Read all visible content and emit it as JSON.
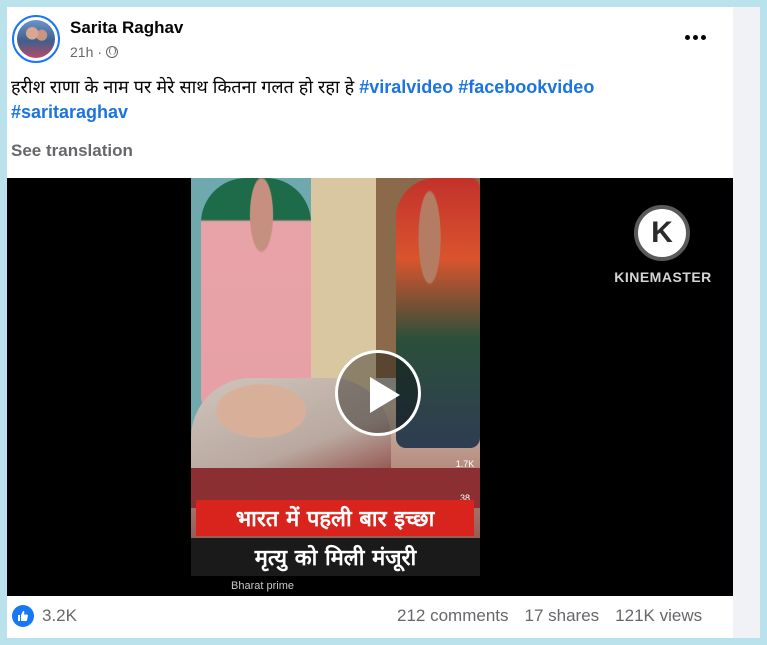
{
  "post": {
    "author": "Sarita Raghav",
    "time": "21h",
    "separator": "·",
    "caption_text": "हरीश राणा के नाम पर मेरे साथ कितना गलत हो रहा हे",
    "hashtags": [
      "#viralvideo",
      "#facebookvideo",
      "#saritaraghav"
    ],
    "see_translation": "See translation"
  },
  "video": {
    "watermark": "KINEMASTER",
    "logo_letter": "K",
    "banner_line1": "भारत में पहली बार इच्छा",
    "banner_line2": "मृत्यु को मिली मंजूरी",
    "channel_text": "Bharat prime",
    "side_counts": [
      "1.7K",
      "38",
      "10"
    ]
  },
  "footer": {
    "reactions": "3.2K",
    "comments": "212 comments",
    "shares": "17 shares",
    "views": "121K views"
  },
  "colors": {
    "accent": "#1b74e4",
    "background": "#b9e2ec",
    "banner_red": "#d9241d"
  },
  "icons": [
    "globe-icon",
    "more-options-icon",
    "play-icon",
    "like-icon",
    "kinemaster-logo-icon"
  ]
}
